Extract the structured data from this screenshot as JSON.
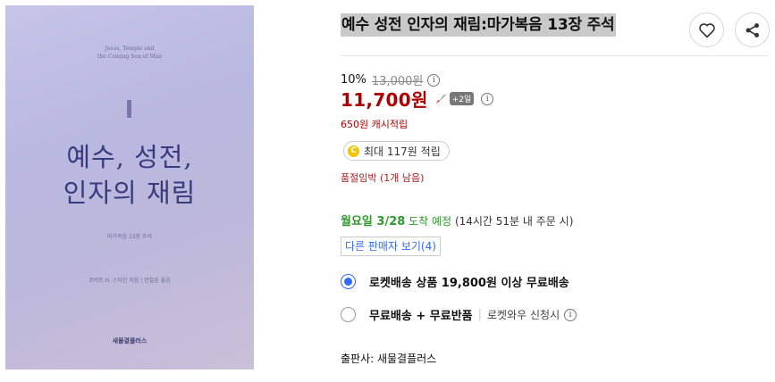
{
  "cover": {
    "en_lines": [
      "Jesus, Temple and",
      "the Coming Son of Man"
    ],
    "title_lines": [
      "예수, 성전,",
      "인자의 재림"
    ],
    "subtitle": "마가복음 13장 주석",
    "authors": "로버트 H. 스타인 지음  |  안철훈 옮김",
    "publisher_mark": "새물결플러스"
  },
  "product": {
    "title": "예수 성전 인자의 재림:마가복음 13장 주석"
  },
  "price": {
    "discount": "10%",
    "original": "13,000원",
    "final": "11,700원",
    "badge": "+2일",
    "cash": "650원 캐시적립",
    "points": "최대 117원 적립",
    "coin_letter": "C",
    "stock": "품절임박 (1개 남음)"
  },
  "delivery": {
    "day": "월요일 3/28",
    "word": "도착 예정",
    "note": "(14시간 51분 내 주문 시)"
  },
  "sellers_label": "다른 판매자 보기(4)",
  "options": [
    {
      "label": "로켓배송 상품 19,800원 이상 무료배송",
      "selected": true
    },
    {
      "label": "무료배송 + 무료반품",
      "sub": "로켓와우 신청시",
      "selected": false
    }
  ],
  "publisher": "출판사: 새물결플러스",
  "colors": {
    "price": "#ae0000",
    "accent": "#346aff",
    "delivery": "#2e9a2e",
    "cover": "#c5c4e8"
  },
  "icons": [
    "heart-icon",
    "share-icon",
    "info-icon",
    "rocket-icon",
    "coin-icon"
  ]
}
